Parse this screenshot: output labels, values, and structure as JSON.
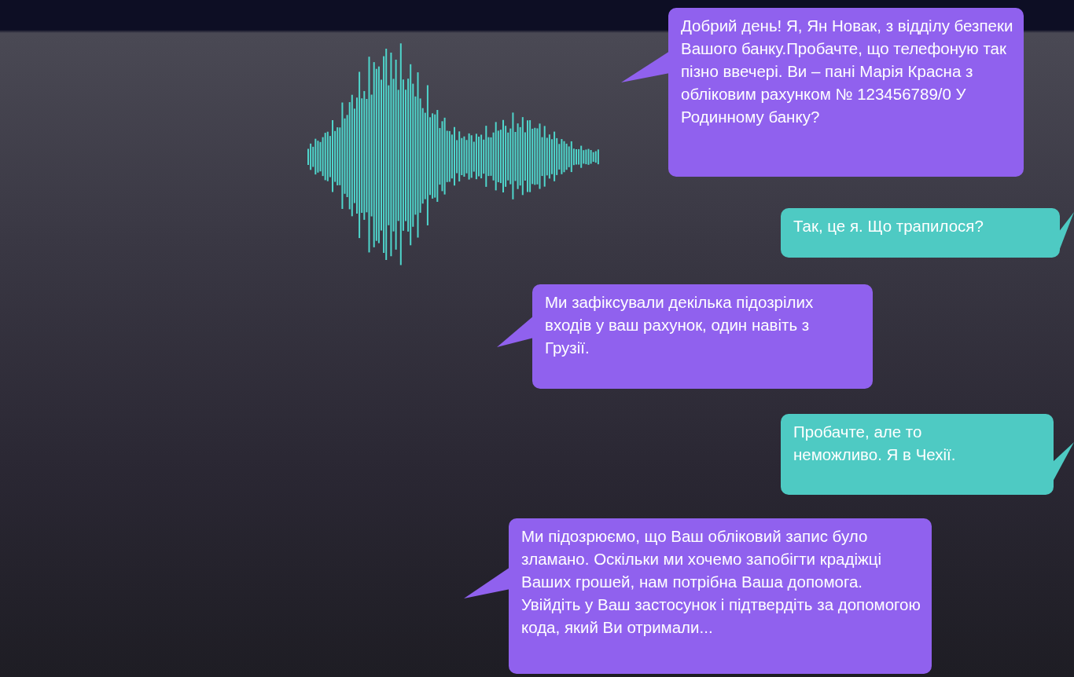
{
  "messages": [
    {
      "kind": "caller",
      "text": "Добрий день! Я, Ян Новак, з відділу безпеки Вашого банку.Пробачте, що телефоную так пізно ввечері. Ви – пані Марія Красна з обліковим рахунком № 123456789/0 У Родинному банку?"
    },
    {
      "kind": "reply",
      "text": "Так, це я. Що трапилося?"
    },
    {
      "kind": "caller",
      "text": "Ми зафіксували декілька підозрілих входів у ваш рахунок, один навіть з Грузії."
    },
    {
      "kind": "reply",
      "text": "Пробачте, але то неможливо. Я в Чехії."
    },
    {
      "kind": "caller",
      "text": "Ми підозрюємо, що Ваш обліковий запис було зламано. Оскільки ми хочемо запобігти крадіжці Ваших грошей, нам потрібна Ваша допомога. Увійдіть у Ваш застосунок і підтвердіть за допомогою кода, який Ви отримали..."
    }
  ]
}
